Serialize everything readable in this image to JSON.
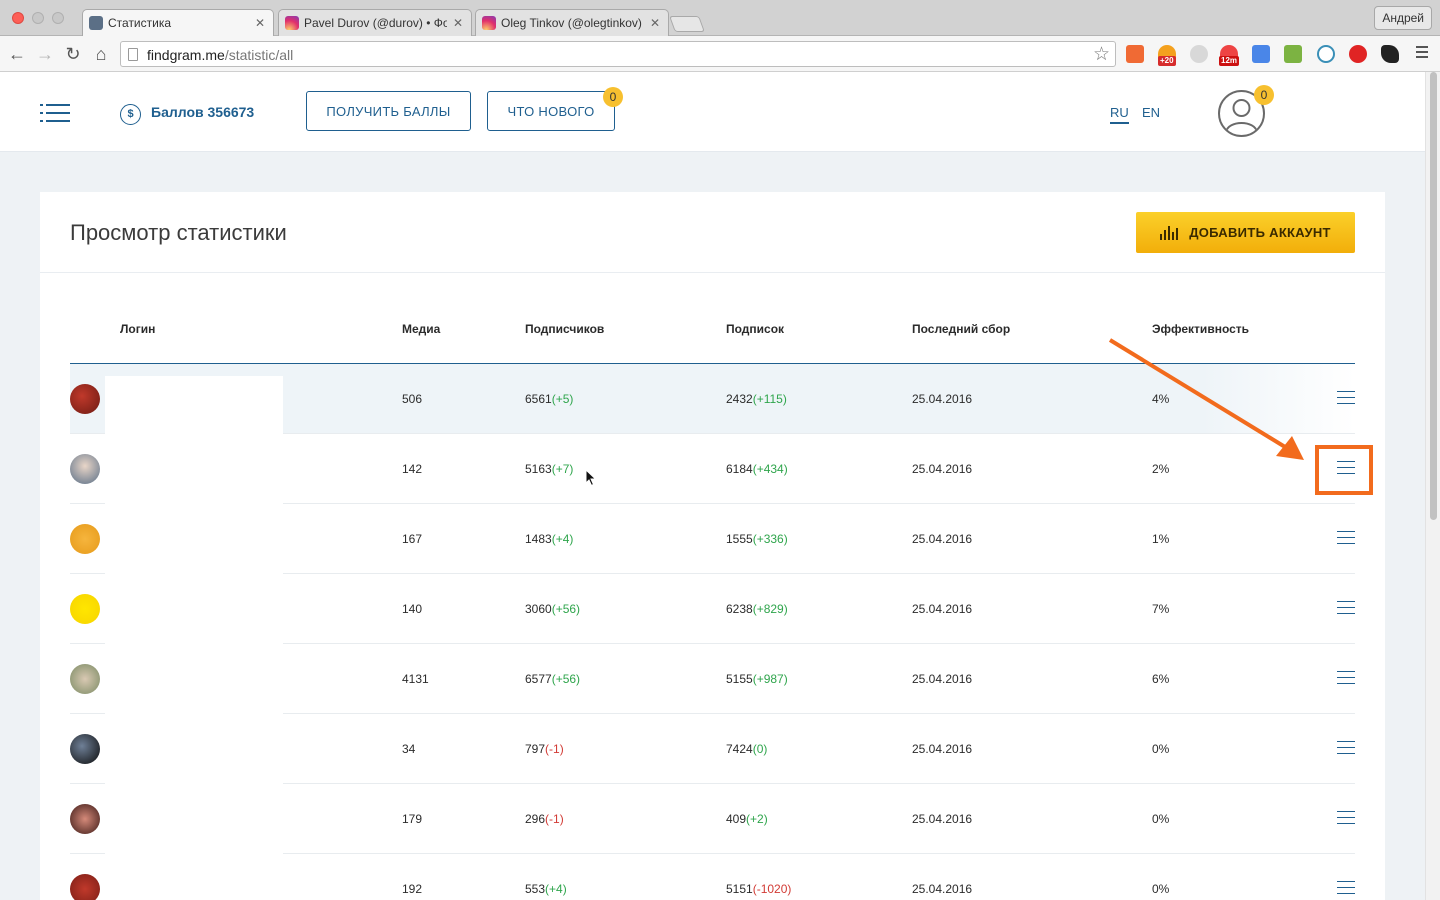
{
  "browser": {
    "tabs": [
      {
        "title": "Статистика",
        "active": true
      },
      {
        "title": "Pavel Durov (@durov) • Фо",
        "active": false
      },
      {
        "title": "Oleg Tinkov (@olegtinkov)",
        "active": false
      }
    ],
    "profile_name": "Андрей",
    "url_host": "findgram.me",
    "url_path": "/statistic/all"
  },
  "header": {
    "balance_label": "Баллов 356673",
    "coin_symbol": "$",
    "get_points_label": "ПОЛУЧИТЬ БАЛЛЫ",
    "whats_new_label": "ЧТО НОВОГО",
    "whats_new_badge": "0",
    "lang_ru": "RU",
    "lang_en": "EN",
    "user_badge": "0"
  },
  "card": {
    "title": "Просмотр статистики",
    "add_account_label": "ДОБАВИТЬ АККАУНТ"
  },
  "table": {
    "columns": {
      "login": "Логин",
      "media": "Медиа",
      "followers": "Подписчиков",
      "following": "Подписок",
      "last_collect": "Последний сбор",
      "efficiency": "Эффективность"
    },
    "rows": [
      {
        "media": "506",
        "followers": "6561",
        "followers_delta": "(+5)",
        "followers_pos": true,
        "following": "2432",
        "following_delta": "(+115)",
        "following_pos": true,
        "date": "25.04.2016",
        "efficiency": "4%"
      },
      {
        "media": "142",
        "followers": "5163",
        "followers_delta": "(+7)",
        "followers_pos": true,
        "following": "6184",
        "following_delta": "(+434)",
        "following_pos": true,
        "date": "25.04.2016",
        "efficiency": "2%"
      },
      {
        "media": "167",
        "followers": "1483",
        "followers_delta": "(+4)",
        "followers_pos": true,
        "following": "1555",
        "following_delta": "(+336)",
        "following_pos": true,
        "date": "25.04.2016",
        "efficiency": "1%"
      },
      {
        "media": "140",
        "followers": "3060",
        "followers_delta": "(+56)",
        "followers_pos": true,
        "following": "6238",
        "following_delta": "(+829)",
        "following_pos": true,
        "date": "25.04.2016",
        "efficiency": "7%"
      },
      {
        "media": "4131",
        "followers": "6577",
        "followers_delta": "(+56)",
        "followers_pos": true,
        "following": "5155",
        "following_delta": "(+987)",
        "following_pos": true,
        "date": "25.04.2016",
        "efficiency": "6%"
      },
      {
        "media": "34",
        "followers": "797",
        "followers_delta": "(-1)",
        "followers_pos": false,
        "following": "7424",
        "following_delta": "(0)",
        "following_pos": true,
        "date": "25.04.2016",
        "efficiency": "0%"
      },
      {
        "media": "179",
        "followers": "296",
        "followers_delta": "(-1)",
        "followers_pos": false,
        "following": "409",
        "following_delta": "(+2)",
        "following_pos": true,
        "date": "25.04.2016",
        "efficiency": "0%"
      },
      {
        "media": "192",
        "followers": "553",
        "followers_delta": "(+4)",
        "followers_pos": true,
        "following": "5151",
        "following_delta": "(-1020)",
        "following_pos": false,
        "date": "25.04.2016",
        "efficiency": "0%"
      }
    ]
  },
  "colors": {
    "brand_blue": "#1f5f8f",
    "accent_yellow": "#f7c02f",
    "positive": "#2fa54c",
    "negative": "#d23b35",
    "annotation_orange": "#f26b1d"
  }
}
